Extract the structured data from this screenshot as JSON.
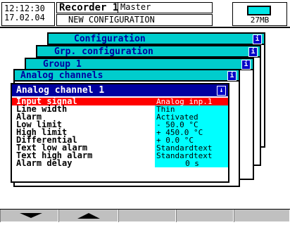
{
  "header": {
    "time": "12:12:30",
    "date": "17.02.04",
    "title": "Recorder 1",
    "role": "Master",
    "subtitle": "NEW CONFIGURATION",
    "memory": "27MB"
  },
  "panels": {
    "configuration": "Configuration",
    "group_configuration": "Grp. configuration",
    "group": "Group 1",
    "analog_channels": "Analog channels",
    "analog_channel": "Analog channel 1"
  },
  "rows": [
    {
      "label": "Input signal",
      "value": "Analog inp.1",
      "selected": true
    },
    {
      "label": "Line width",
      "value": "Thin"
    },
    {
      "label": "Alarm",
      "value": "Activated"
    },
    {
      "label": "Low limit",
      "value": "-   50.0 °C"
    },
    {
      "label": "High limit",
      "value": "+ 450.0 °C"
    },
    {
      "label": "Differential",
      "value": "+    0.0 °C"
    },
    {
      "label": "Text low alarm",
      "value": "Standardtext"
    },
    {
      "label": "Text high alarm",
      "value": "Standardtext"
    },
    {
      "label": "Alarm delay",
      "value": "0 s"
    }
  ],
  "colors": {
    "panel_cyan": "#00cdcd",
    "value_cyan": "#00ffff",
    "title_blue": "#0000a0",
    "selection_red": "#ff0000"
  },
  "softkeys": [
    {
      "icon": "arrow-down-icon"
    },
    {
      "icon": "arrow-up-icon"
    },
    {
      "icon": ""
    },
    {
      "icon": ""
    },
    {
      "icon": ""
    }
  ]
}
